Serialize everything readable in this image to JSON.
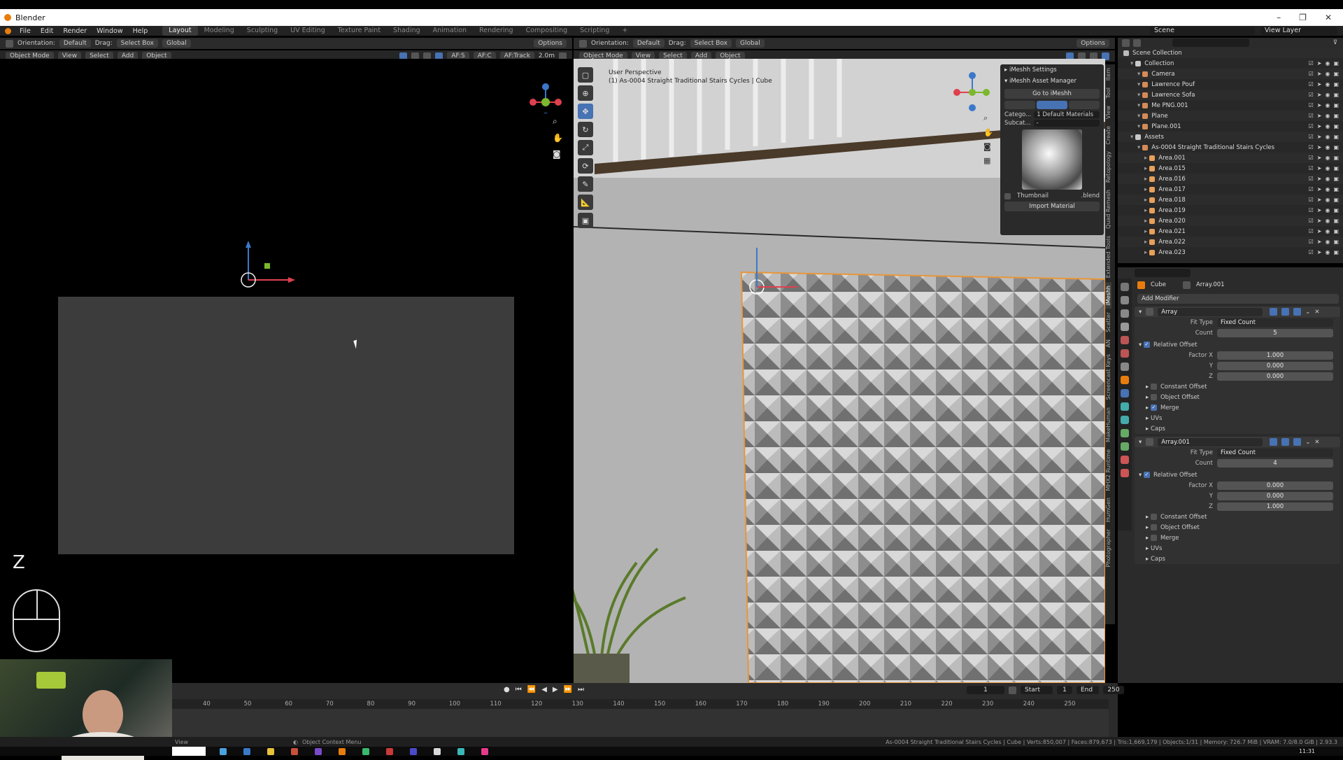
{
  "window": {
    "title": "Blender",
    "controls": [
      "–",
      "❐",
      "✕"
    ]
  },
  "menu": {
    "items": [
      "File",
      "Edit",
      "Render",
      "Window",
      "Help"
    ],
    "workspaces": [
      "Layout",
      "Modeling",
      "Sculpting",
      "UV Editing",
      "Texture Paint",
      "Shading",
      "Animation",
      "Rendering",
      "Compositing",
      "Scripting",
      "+"
    ],
    "active_workspace": "Layout",
    "scene_label": "Scene",
    "view_layer_label": "View Layer"
  },
  "left_header": {
    "orientation_label": "Orientation:",
    "orientation_value": "Default",
    "drag_label": "Drag:",
    "drag_value": "Select Box",
    "transform": "Global",
    "options": "Options",
    "mode": "Object Mode",
    "menus": [
      "View",
      "Select",
      "Add",
      "Object"
    ],
    "af_s": "AF:S",
    "af_c": "AF:C",
    "af_track": "AF:Track",
    "focal": "2.0m"
  },
  "left_view": {
    "axis_label": "Z",
    "tab_label": "View"
  },
  "right_header": {
    "orientation_label": "Orientation:",
    "orientation_value": "Default",
    "drag_label": "Drag:",
    "drag_value": "Select Box",
    "transform": "Global",
    "options": "Options",
    "mode": "Object Mode",
    "menus": [
      "View",
      "Select",
      "Add",
      "Object"
    ]
  },
  "viewport_overlay": {
    "line1": "User Perspective",
    "line2": "(1) As-0004 Straight Traditional Stairs Cycles | Cube"
  },
  "imeshh": {
    "settings": "iMeshh Settings",
    "asset_manager": "iMeshh Asset Manager",
    "go_button": "Go to iMeshh",
    "category_label": "Catego...",
    "category_value": "1 Default Materials",
    "subcategory_label": "Subcat...",
    "subcategory_value": "-",
    "thumbnail": "Thumbnail",
    "blend": ".blend",
    "import": "Import Material"
  },
  "side_tabs": [
    "Item",
    "Tool",
    "View",
    "Create",
    "Retopology",
    "Quad Remesh",
    "Extended Tools",
    "iMeshh",
    "Scatter",
    "AN",
    "Screencast Keys",
    "MakeHuman",
    "MHX2 Runtime",
    "HumGen",
    "Photographer"
  ],
  "outliner": {
    "title": "Scene Collection",
    "rows": [
      {
        "name": "Collection",
        "indent": 1,
        "color": "#c8c8c8"
      },
      {
        "name": "Camera",
        "indent": 2,
        "color": "#d48b58"
      },
      {
        "name": "Lawrence Pouf",
        "indent": 2,
        "color": "#d48b58"
      },
      {
        "name": "Lawrence Sofa",
        "indent": 2,
        "color": "#d48b58"
      },
      {
        "name": "Me PNG.001",
        "indent": 2,
        "color": "#d48b58"
      },
      {
        "name": "Plane",
        "indent": 2,
        "color": "#d48b58"
      },
      {
        "name": "Plane.001",
        "indent": 2,
        "color": "#d48b58"
      },
      {
        "name": "Assets",
        "indent": 1,
        "color": "#c8c8c8"
      },
      {
        "name": "As-0004 Straight Traditional Stairs Cycles",
        "indent": 2,
        "color": "#d48b58"
      },
      {
        "name": "Area.001",
        "indent": 3,
        "color": "#e8a05a"
      },
      {
        "name": "Area.015",
        "indent": 3,
        "color": "#e8a05a"
      },
      {
        "name": "Area.016",
        "indent": 3,
        "color": "#e8a05a"
      },
      {
        "name": "Area.017",
        "indent": 3,
        "color": "#e8a05a"
      },
      {
        "name": "Area.018",
        "indent": 3,
        "color": "#e8a05a"
      },
      {
        "name": "Area.019",
        "indent": 3,
        "color": "#e8a05a"
      },
      {
        "name": "Area.020",
        "indent": 3,
        "color": "#e8a05a"
      },
      {
        "name": "Area.021",
        "indent": 3,
        "color": "#e8a05a"
      },
      {
        "name": "Area.022",
        "indent": 3,
        "color": "#e8a05a"
      },
      {
        "name": "Area.023",
        "indent": 3,
        "color": "#e8a05a"
      }
    ]
  },
  "properties": {
    "object": "Cube",
    "modifier_name": "Array.001",
    "add_modifier": "Add Modifier",
    "modifiers": [
      {
        "name": "Array",
        "fit_type_label": "Fit Type",
        "fit_type": "Fixed Count",
        "count_label": "Count",
        "count": "5",
        "relative_offset": "Relative Offset",
        "factors": [
          {
            "label": "Factor X",
            "value": "1.000"
          },
          {
            "label": "Y",
            "value": "0.000"
          },
          {
            "label": "Z",
            "value": "0.000"
          }
        ],
        "subpanels": [
          {
            "label": "Constant Offset",
            "on": false
          },
          {
            "label": "Object Offset",
            "on": false
          },
          {
            "label": "Merge",
            "on": true
          },
          {
            "label": "UVs",
            "on": null
          },
          {
            "label": "Caps",
            "on": null
          }
        ]
      },
      {
        "name": "Array.001",
        "fit_type_label": "Fit Type",
        "fit_type": "Fixed Count",
        "count_label": "Count",
        "count": "4",
        "relative_offset": "Relative Offset",
        "factors": [
          {
            "label": "Factor X",
            "value": "0.000"
          },
          {
            "label": "Y",
            "value": "0.000"
          },
          {
            "label": "Z",
            "value": "1.000"
          }
        ],
        "subpanels": [
          {
            "label": "Constant Offset",
            "on": false
          },
          {
            "label": "Object Offset",
            "on": false
          },
          {
            "label": "Merge",
            "on": false
          },
          {
            "label": "UVs",
            "on": null
          },
          {
            "label": "Caps",
            "on": null
          }
        ]
      }
    ]
  },
  "timeline": {
    "current_frame": "1",
    "start_label": "Start",
    "start": "1",
    "end_label": "End",
    "end": "250",
    "ticks": [
      "40",
      "50",
      "60",
      "70",
      "80",
      "90",
      "100",
      "110",
      "120",
      "130",
      "140",
      "150",
      "160",
      "170",
      "180",
      "190",
      "200",
      "210",
      "220",
      "230",
      "240",
      "250"
    ]
  },
  "status": {
    "left": "View",
    "context": "Object Context Menu",
    "right": "As-0004 Straight Traditional Stairs Cycles | Cube | Verts:850,007 | Faces:879,673 | Tris:1,669,179 | Objects:1/31 | Memory: 726.7 MiB | VRAM: 7.0/8.0 GiB | 2.93.3"
  },
  "taskbar": {
    "time": "11:31"
  },
  "colors": {
    "accent": "#4772b3",
    "selection": "#e87d0d",
    "x_axis": "#e0404e",
    "y_axis": "#7bb82d",
    "z_axis": "#3a78c9"
  }
}
